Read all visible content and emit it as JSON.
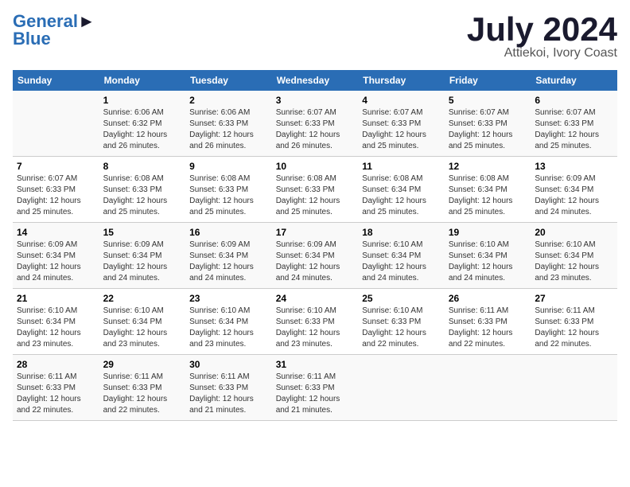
{
  "header": {
    "logo_line1": "General",
    "logo_line2": "Blue",
    "title": "July 2024",
    "subtitle": "Attiekoi, Ivory Coast"
  },
  "calendar": {
    "days_of_week": [
      "Sunday",
      "Monday",
      "Tuesday",
      "Wednesday",
      "Thursday",
      "Friday",
      "Saturday"
    ],
    "weeks": [
      [
        {
          "day": "",
          "info": ""
        },
        {
          "day": "1",
          "info": "Sunrise: 6:06 AM\nSunset: 6:32 PM\nDaylight: 12 hours\nand 26 minutes."
        },
        {
          "day": "2",
          "info": "Sunrise: 6:06 AM\nSunset: 6:33 PM\nDaylight: 12 hours\nand 26 minutes."
        },
        {
          "day": "3",
          "info": "Sunrise: 6:07 AM\nSunset: 6:33 PM\nDaylight: 12 hours\nand 26 minutes."
        },
        {
          "day": "4",
          "info": "Sunrise: 6:07 AM\nSunset: 6:33 PM\nDaylight: 12 hours\nand 25 minutes."
        },
        {
          "day": "5",
          "info": "Sunrise: 6:07 AM\nSunset: 6:33 PM\nDaylight: 12 hours\nand 25 minutes."
        },
        {
          "day": "6",
          "info": "Sunrise: 6:07 AM\nSunset: 6:33 PM\nDaylight: 12 hours\nand 25 minutes."
        }
      ],
      [
        {
          "day": "7",
          "info": "Sunrise: 6:07 AM\nSunset: 6:33 PM\nDaylight: 12 hours\nand 25 minutes."
        },
        {
          "day": "8",
          "info": "Sunrise: 6:08 AM\nSunset: 6:33 PM\nDaylight: 12 hours\nand 25 minutes."
        },
        {
          "day": "9",
          "info": "Sunrise: 6:08 AM\nSunset: 6:33 PM\nDaylight: 12 hours\nand 25 minutes."
        },
        {
          "day": "10",
          "info": "Sunrise: 6:08 AM\nSunset: 6:33 PM\nDaylight: 12 hours\nand 25 minutes."
        },
        {
          "day": "11",
          "info": "Sunrise: 6:08 AM\nSunset: 6:34 PM\nDaylight: 12 hours\nand 25 minutes."
        },
        {
          "day": "12",
          "info": "Sunrise: 6:08 AM\nSunset: 6:34 PM\nDaylight: 12 hours\nand 25 minutes."
        },
        {
          "day": "13",
          "info": "Sunrise: 6:09 AM\nSunset: 6:34 PM\nDaylight: 12 hours\nand 24 minutes."
        }
      ],
      [
        {
          "day": "14",
          "info": "Sunrise: 6:09 AM\nSunset: 6:34 PM\nDaylight: 12 hours\nand 24 minutes."
        },
        {
          "day": "15",
          "info": "Sunrise: 6:09 AM\nSunset: 6:34 PM\nDaylight: 12 hours\nand 24 minutes."
        },
        {
          "day": "16",
          "info": "Sunrise: 6:09 AM\nSunset: 6:34 PM\nDaylight: 12 hours\nand 24 minutes."
        },
        {
          "day": "17",
          "info": "Sunrise: 6:09 AM\nSunset: 6:34 PM\nDaylight: 12 hours\nand 24 minutes."
        },
        {
          "day": "18",
          "info": "Sunrise: 6:10 AM\nSunset: 6:34 PM\nDaylight: 12 hours\nand 24 minutes."
        },
        {
          "day": "19",
          "info": "Sunrise: 6:10 AM\nSunset: 6:34 PM\nDaylight: 12 hours\nand 24 minutes."
        },
        {
          "day": "20",
          "info": "Sunrise: 6:10 AM\nSunset: 6:34 PM\nDaylight: 12 hours\nand 23 minutes."
        }
      ],
      [
        {
          "day": "21",
          "info": "Sunrise: 6:10 AM\nSunset: 6:34 PM\nDaylight: 12 hours\nand 23 minutes."
        },
        {
          "day": "22",
          "info": "Sunrise: 6:10 AM\nSunset: 6:34 PM\nDaylight: 12 hours\nand 23 minutes."
        },
        {
          "day": "23",
          "info": "Sunrise: 6:10 AM\nSunset: 6:34 PM\nDaylight: 12 hours\nand 23 minutes."
        },
        {
          "day": "24",
          "info": "Sunrise: 6:10 AM\nSunset: 6:33 PM\nDaylight: 12 hours\nand 23 minutes."
        },
        {
          "day": "25",
          "info": "Sunrise: 6:10 AM\nSunset: 6:33 PM\nDaylight: 12 hours\nand 22 minutes."
        },
        {
          "day": "26",
          "info": "Sunrise: 6:11 AM\nSunset: 6:33 PM\nDaylight: 12 hours\nand 22 minutes."
        },
        {
          "day": "27",
          "info": "Sunrise: 6:11 AM\nSunset: 6:33 PM\nDaylight: 12 hours\nand 22 minutes."
        }
      ],
      [
        {
          "day": "28",
          "info": "Sunrise: 6:11 AM\nSunset: 6:33 PM\nDaylight: 12 hours\nand 22 minutes."
        },
        {
          "day": "29",
          "info": "Sunrise: 6:11 AM\nSunset: 6:33 PM\nDaylight: 12 hours\nand 22 minutes."
        },
        {
          "day": "30",
          "info": "Sunrise: 6:11 AM\nSunset: 6:33 PM\nDaylight: 12 hours\nand 21 minutes."
        },
        {
          "day": "31",
          "info": "Sunrise: 6:11 AM\nSunset: 6:33 PM\nDaylight: 12 hours\nand 21 minutes."
        },
        {
          "day": "",
          "info": ""
        },
        {
          "day": "",
          "info": ""
        },
        {
          "day": "",
          "info": ""
        }
      ]
    ]
  }
}
